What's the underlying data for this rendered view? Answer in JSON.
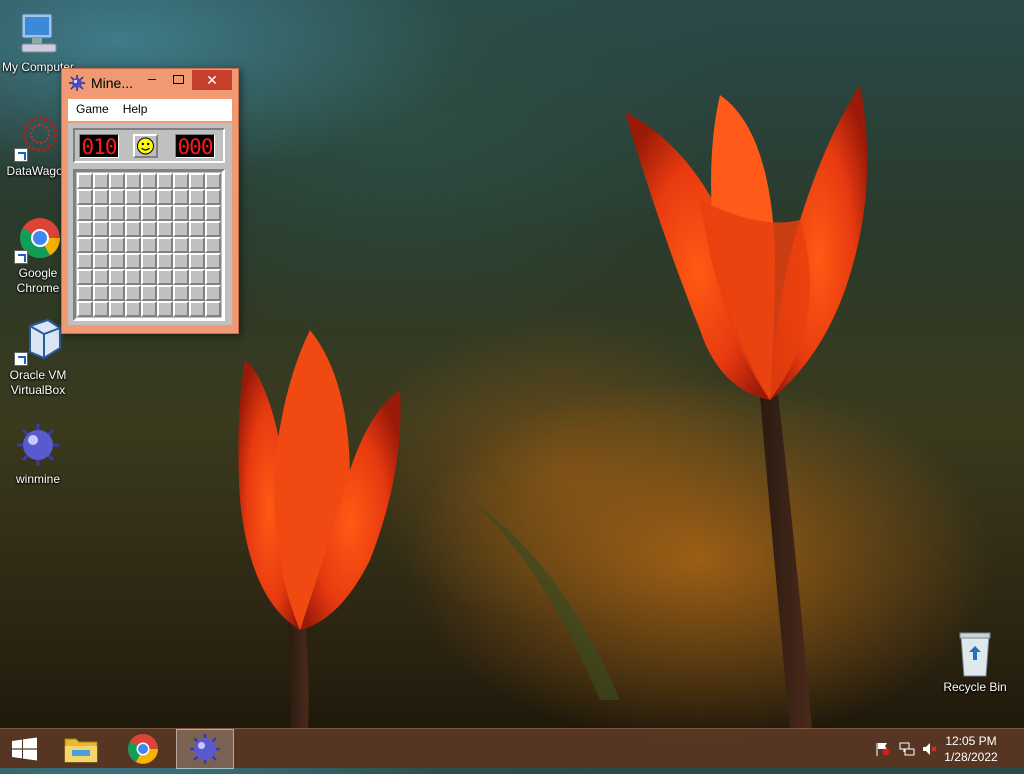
{
  "desktop": {
    "icons": [
      {
        "label": "My Computer"
      },
      {
        "label": "DataWagon"
      },
      {
        "label": "Google Chrome"
      },
      {
        "label": "Oracle VM VirtualBox"
      },
      {
        "label": "winmine"
      },
      {
        "label": "Recycle Bin"
      }
    ]
  },
  "minesweeper": {
    "title": "Mine...",
    "window_controls": {
      "minimize": "–",
      "maximize": "",
      "close": "✕"
    },
    "menu": [
      {
        "label": "Game"
      },
      {
        "label": "Help"
      }
    ],
    "mine_counter": "010",
    "timer": "000",
    "face_icon": "smiley-face",
    "grid": {
      "rows": 9,
      "cols": 9,
      "state": "all-unrevealed"
    }
  },
  "taskbar": {
    "buttons": [
      {
        "name": "start-button",
        "icon": "windows-logo"
      },
      {
        "name": "file-explorer",
        "icon": "folder"
      },
      {
        "name": "google-chrome",
        "icon": "chrome"
      },
      {
        "name": "minesweeper",
        "icon": "mine",
        "active": true
      }
    ],
    "tray": [
      {
        "icon": "action-center-flag"
      },
      {
        "icon": "network"
      },
      {
        "icon": "volume-muted"
      }
    ],
    "time": "12:05 PM",
    "date": "1/28/2022"
  },
  "colors": {
    "window_frame": "#ef9a73",
    "close_button": "#c7402d",
    "lcd_digit": "#ff1a1a",
    "taskbar": "#603c28"
  }
}
